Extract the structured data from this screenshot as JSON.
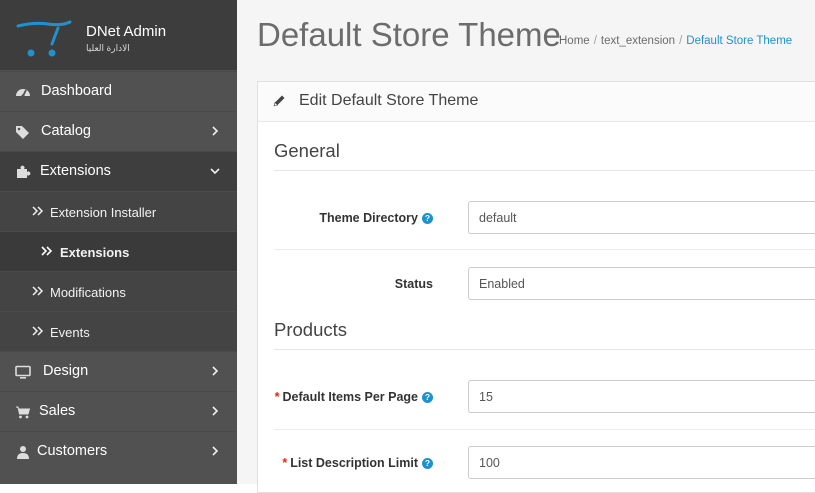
{
  "brand": {
    "title": "DNet Admin",
    "subtitle": "الادارة العليا"
  },
  "sidebar": {
    "items": [
      {
        "label": "Dashboard",
        "icon": "dashboard-icon"
      },
      {
        "label": "Catalog",
        "icon": "tags-icon"
      },
      {
        "label": "Extensions",
        "icon": "puzzle-icon",
        "expanded": true
      },
      {
        "label": "Design",
        "icon": "television-icon"
      },
      {
        "label": "Sales",
        "icon": "shopping-cart-icon"
      },
      {
        "label": "Customers",
        "icon": "user-icon"
      }
    ],
    "sub_items": [
      {
        "label": "Extension Installer"
      },
      {
        "label": "Extensions",
        "active": true
      },
      {
        "label": "Modifications"
      },
      {
        "label": "Events"
      }
    ]
  },
  "page": {
    "title": "Default Store Theme"
  },
  "breadcrumb": [
    "Home",
    "text_extension",
    "Default Store Theme"
  ],
  "panel": {
    "title": "Edit Default Store Theme",
    "sections": {
      "general": "General",
      "products": "Products"
    },
    "fields": {
      "theme_directory": {
        "label": "Theme Directory",
        "value": "default"
      },
      "status": {
        "label": "Status",
        "value": "Enabled"
      },
      "items_per_page": {
        "label": "Default Items Per Page",
        "value": "15",
        "required": true
      },
      "description_limit": {
        "label": "List Description Limit",
        "value": "100",
        "required": true
      }
    }
  },
  "colors": {
    "accent": "#1e91cf",
    "required": "#e8280c",
    "sidebar": "#515151"
  }
}
